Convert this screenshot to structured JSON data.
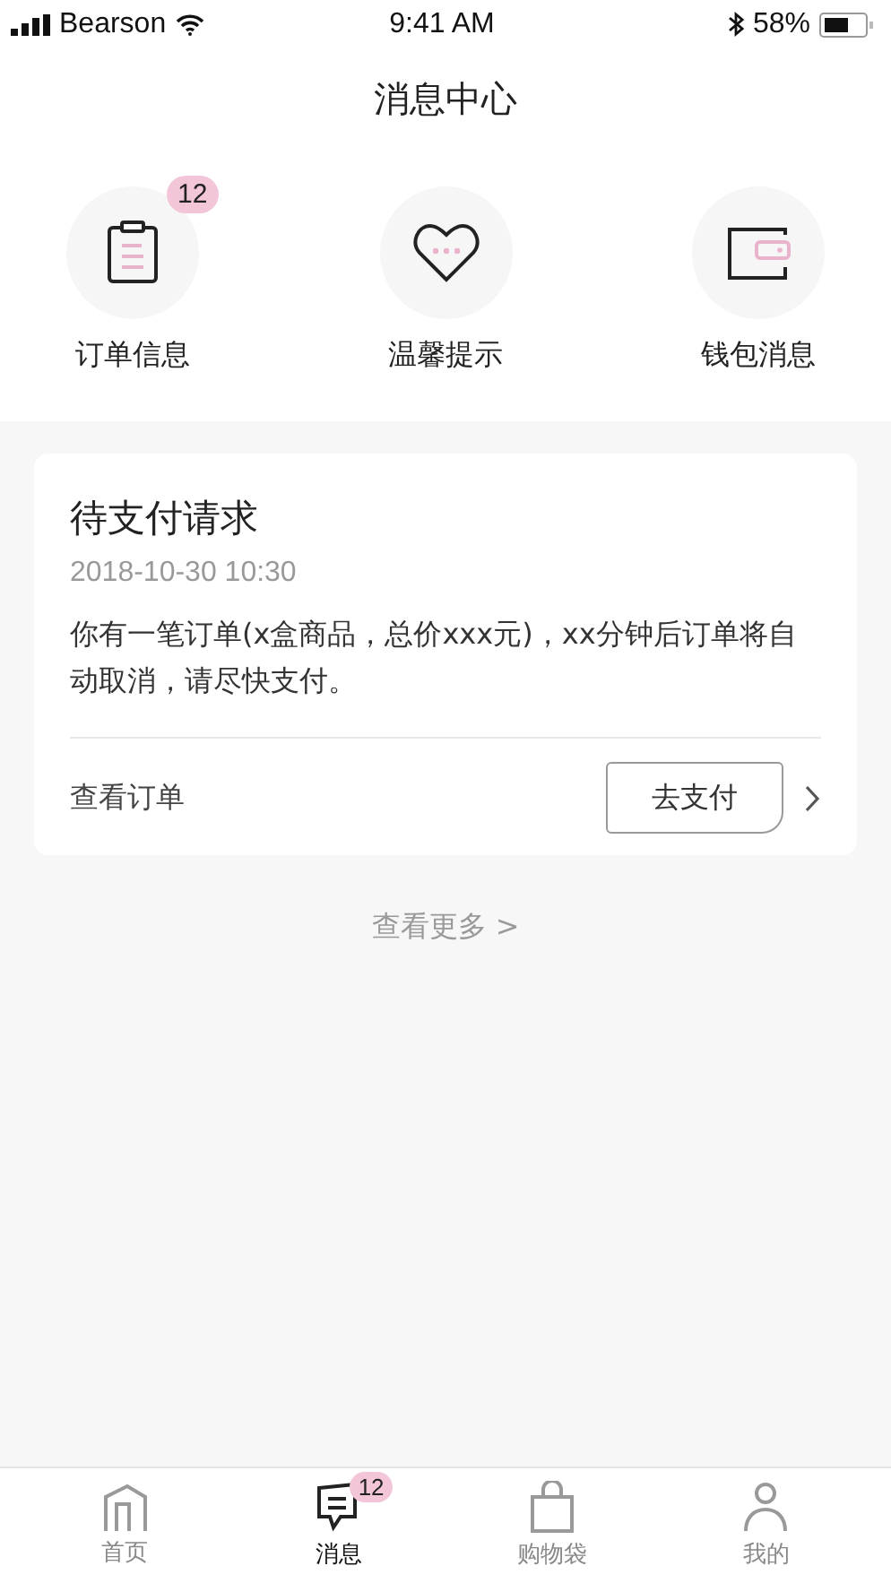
{
  "status_bar": {
    "carrier": "Bearson",
    "time": "9:41 AM",
    "battery": "58%"
  },
  "title": "消息中心",
  "categories": [
    {
      "kind": "clipboard",
      "label": "订单信息",
      "badge": "12"
    },
    {
      "kind": "heart",
      "label": "温馨提示"
    },
    {
      "kind": "wallet",
      "label": "钱包消息"
    }
  ],
  "message": {
    "title": "待支付请求",
    "time": "2018-10-30 10:30",
    "body": "你有一笔订单(x盒商品，总价xxx元)，xx分钟后订单将自动取消，请尽快支付。",
    "link": "查看订单",
    "button": "去支付"
  },
  "more": "查看更多 >",
  "tab_bar": [
    {
      "kind": "home",
      "label": "首页",
      "selected": false
    },
    {
      "kind": "message",
      "label": "消息",
      "selected": true,
      "badge": "12"
    },
    {
      "kind": "bag",
      "label": "购物袋",
      "selected": false
    },
    {
      "kind": "person",
      "label": "我的",
      "selected": false
    }
  ]
}
